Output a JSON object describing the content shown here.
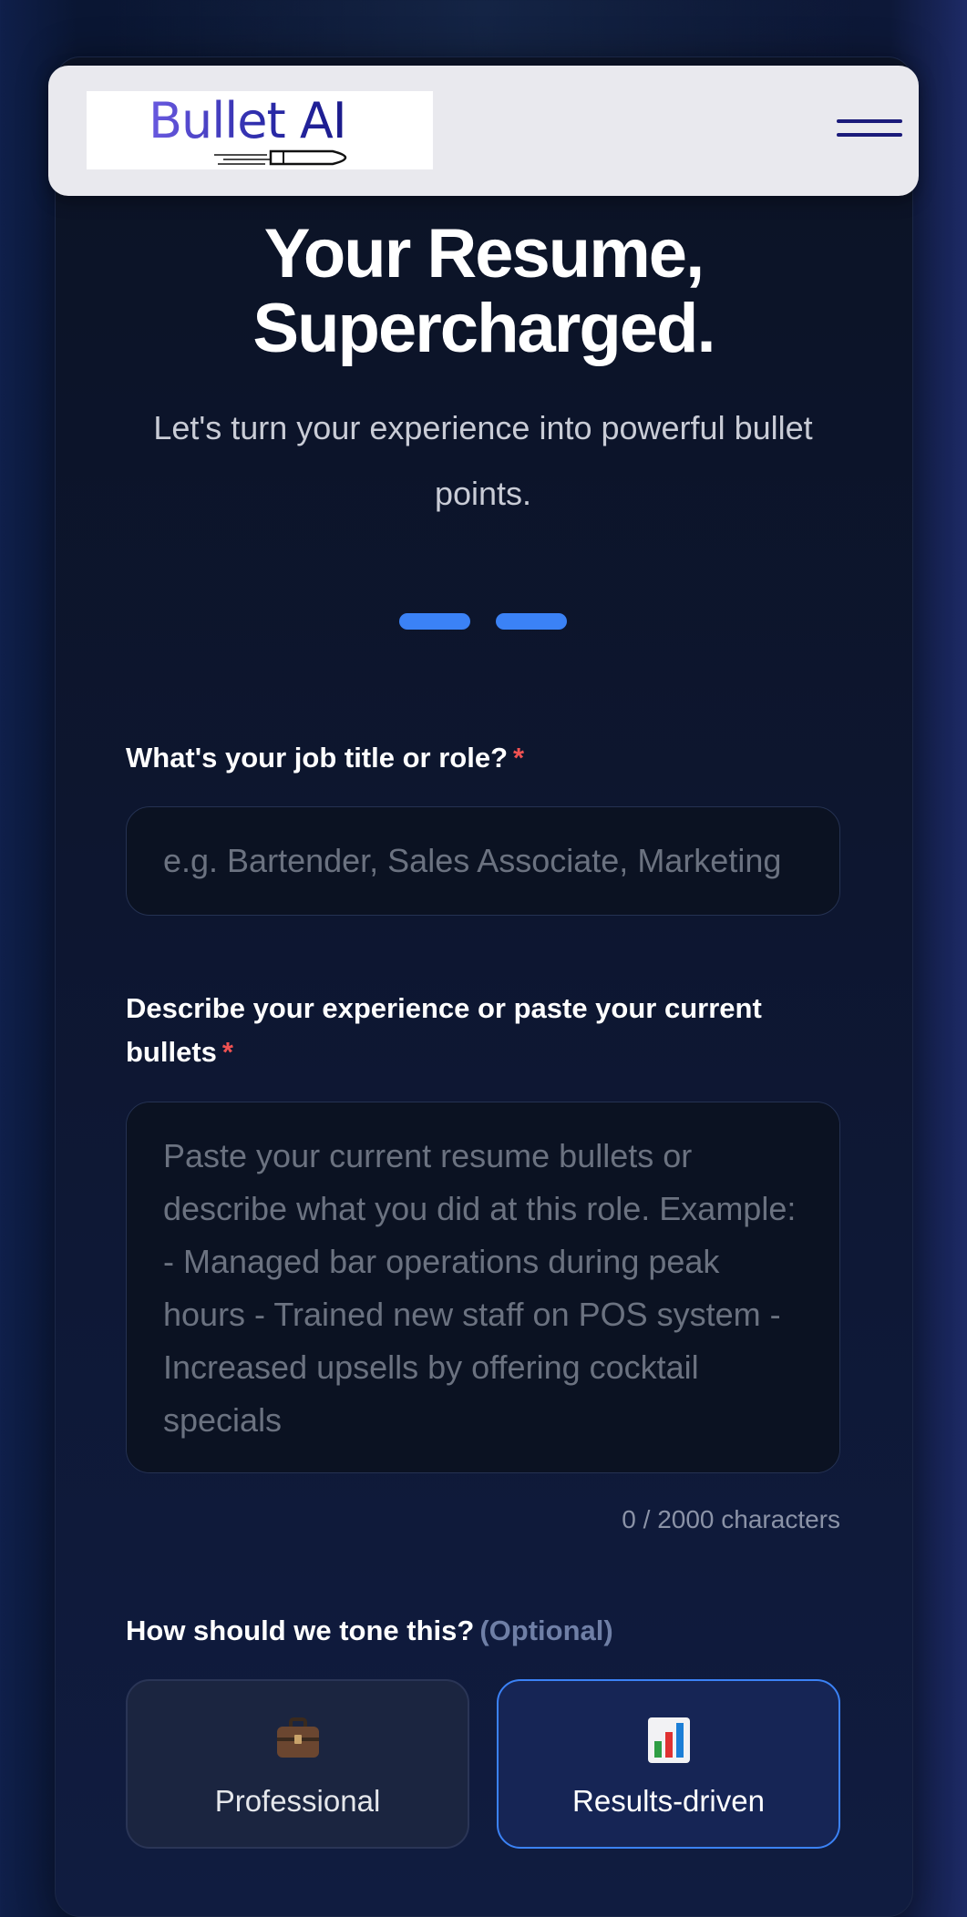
{
  "header": {
    "logo_text": "Bullet AI",
    "menu_icon": "hamburger-menu-icon"
  },
  "hero": {
    "title_line1": "Your Resume,",
    "title_line2": "Supercharged.",
    "subtitle": "Let's turn your experience into powerful bullet points."
  },
  "progress": {
    "steps": 2,
    "color": "#3b82f6"
  },
  "form": {
    "job_title": {
      "label": "What's your job title or role?",
      "required_mark": "*",
      "placeholder": "e.g. Bartender, Sales Associate, Marketing",
      "value": ""
    },
    "experience": {
      "label": "Describe your experience or paste your current bullets",
      "required_mark": "*",
      "placeholder": "Paste your current resume bullets or describe what you did at this role. Example: - Managed bar operations during peak hours - Trained new staff on POS system - Increased upsells by offering cocktail specials",
      "value": "",
      "char_count": "0 / 2000 characters"
    },
    "tone": {
      "label": "How should we tone this?",
      "optional": "(Optional)",
      "options": [
        {
          "label": "Professional",
          "icon": "briefcase-icon",
          "selected": false
        },
        {
          "label": "Results-driven",
          "icon": "bar-chart-icon",
          "selected": true
        }
      ]
    }
  },
  "colors": {
    "accent": "#3b82f6",
    "required": "#f05252",
    "header_bg": "#e9e9ee",
    "logo": "#3b32b8"
  }
}
